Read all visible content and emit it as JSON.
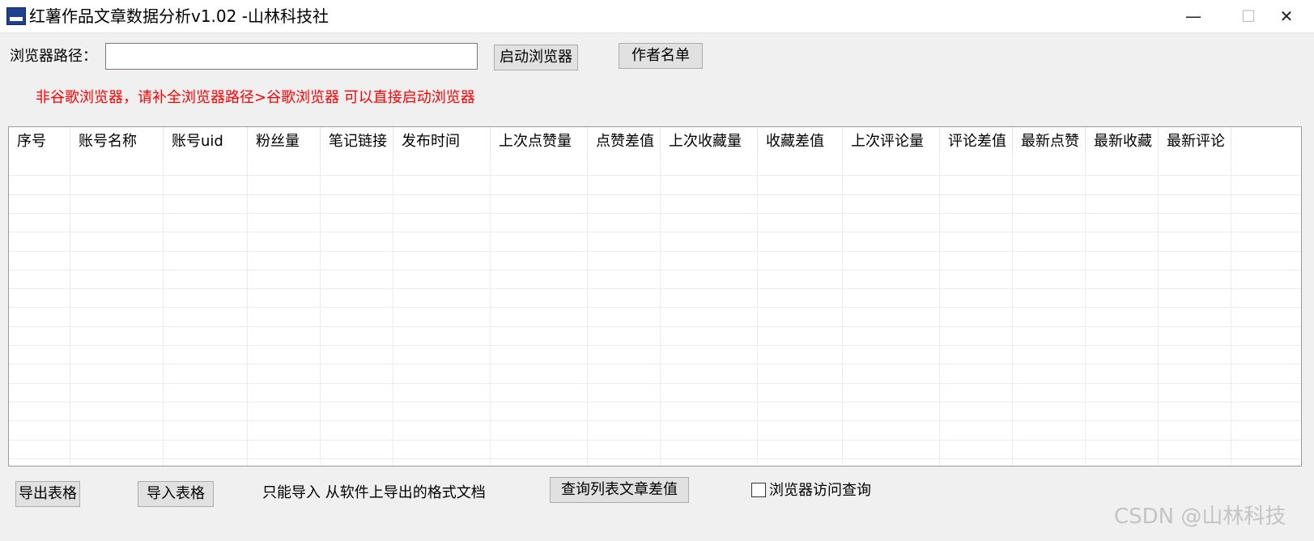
{
  "window": {
    "title": "红薯作品文章数据分析v1.02 -山林科技社",
    "controls": {
      "minimize": "—",
      "maximize": "☐",
      "close": "✕"
    }
  },
  "top_bar": {
    "browser_path_label": "浏览器路径：",
    "browser_path_value": "",
    "launch_browser_button": "启动浏览器",
    "author_list_button": "作者名单"
  },
  "warning": "非谷歌浏览器，请补全浏览器路径>谷歌浏览器 可以直接启动浏览器",
  "table": {
    "columns": [
      "序号",
      "账号名称",
      "账号uid",
      "粉丝量",
      "笔记链接",
      "发布时间",
      "上次点赞量",
      "点赞差值",
      "上次收藏量",
      "收藏差值",
      "上次评论量",
      "评论差值",
      "最新点赞",
      "最新收藏",
      "最新评论"
    ],
    "rows": []
  },
  "bottom_bar": {
    "export_button": "导出表格",
    "import_button": "导入表格",
    "import_note": "只能导入 从软件上导出的格式文档",
    "query_button": "查询列表文章差值",
    "browser_query_checkbox_label": "浏览器访问查询",
    "browser_query_checked": false
  },
  "watermark": "CSDN @山林科技"
}
